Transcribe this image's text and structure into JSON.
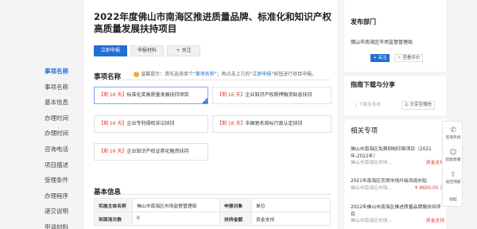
{
  "leftnav": {
    "items": [
      {
        "label": "事项名称",
        "active": true
      },
      {
        "label": "事项名称",
        "active": false
      },
      {
        "label": "基本信息",
        "active": false
      },
      {
        "label": "办理时间",
        "active": false
      },
      {
        "label": "办理时间",
        "active": false
      },
      {
        "label": "咨询电话",
        "active": false
      },
      {
        "label": "项目描述",
        "active": false
      },
      {
        "label": "受理条件",
        "active": false
      },
      {
        "label": "办理程序",
        "active": false
      },
      {
        "label": "递交说明",
        "active": false
      },
      {
        "label": "申请材料",
        "active": false
      }
    ]
  },
  "main": {
    "title": "2022年度佛山市南海区推进质量品牌、标准化和知识产权高质量发展扶持项目",
    "buttons": {
      "apply": "立即申报",
      "materials": "申报材料",
      "follow": "+ 关注"
    },
    "items_section": {
      "heading": "事项名称",
      "hint_icon": "!",
      "hint_prefix": "温馨提示：请先选择单个",
      "hint_link1": "\"事项名称\"",
      "hint_mid": "；再点击上方的",
      "hint_link2": "\"立即申报\"",
      "hint_suffix": "按钮进行项目申报。",
      "items": [
        {
          "tag": "【剩 16 天】",
          "text": "标准化奖高质量发展扶持项目",
          "selected": true
        },
        {
          "tag": "【剩 16 天】",
          "text": "企业知识产权质押融资贴息扶持",
          "selected": false
        },
        {
          "tag": "【剩 16 天】",
          "text": "企业专利侵权诉讼扶持",
          "selected": false
        },
        {
          "tag": "【剩 16 天】",
          "text": "中国驰名商标行政认定扶持",
          "selected": false
        },
        {
          "tag": "【剩 16 天】",
          "text": "企业知识产权证券化融资扶持",
          "selected": false
        }
      ]
    },
    "basic_info": {
      "heading": "基本信息",
      "rows": [
        [
          {
            "k": "实施主体名称",
            "v": "佛山市南海区市场监督管理局"
          },
          {
            "k": "申报对象",
            "v": "单位"
          }
        ],
        [
          {
            "k": "到现场次数",
            "v": "0"
          },
          {
            "k": "扶持金额",
            "v": "资金支持"
          }
        ]
      ]
    }
  },
  "sidebar": {
    "dept": {
      "heading": "发布部门",
      "name": "佛山市南海区市场监督管理局",
      "follow": "+ 关注",
      "evaluate": "☆ 查看评价"
    },
    "share": {
      "heading": "指南下载与分享",
      "download": "下载至本地",
      "share": "分享至微信"
    },
    "related": {
      "heading": "相关专项",
      "items": [
        {
          "title": "佛山市南海区免费刻制印章项目（2021年-2022年）",
          "dept": "佛山市南海区市场...",
          "money": "资金支持"
        },
        {
          "title": "2021年南海区农贸市场升级改造补贴",
          "dept": "佛山市南海区市场...",
          "money": "¥ 8600.00 万"
        },
        {
          "title": "2022年佛山市南海区推进质量品牌展扶持项目",
          "dept": "佛山市南海区市场...",
          "money": "资金支持"
        }
      ]
    }
  },
  "float_bar": {
    "consult": "咨询热线",
    "ai": "智能客服",
    "top": "返回顶部",
    "collapse": "收起"
  }
}
